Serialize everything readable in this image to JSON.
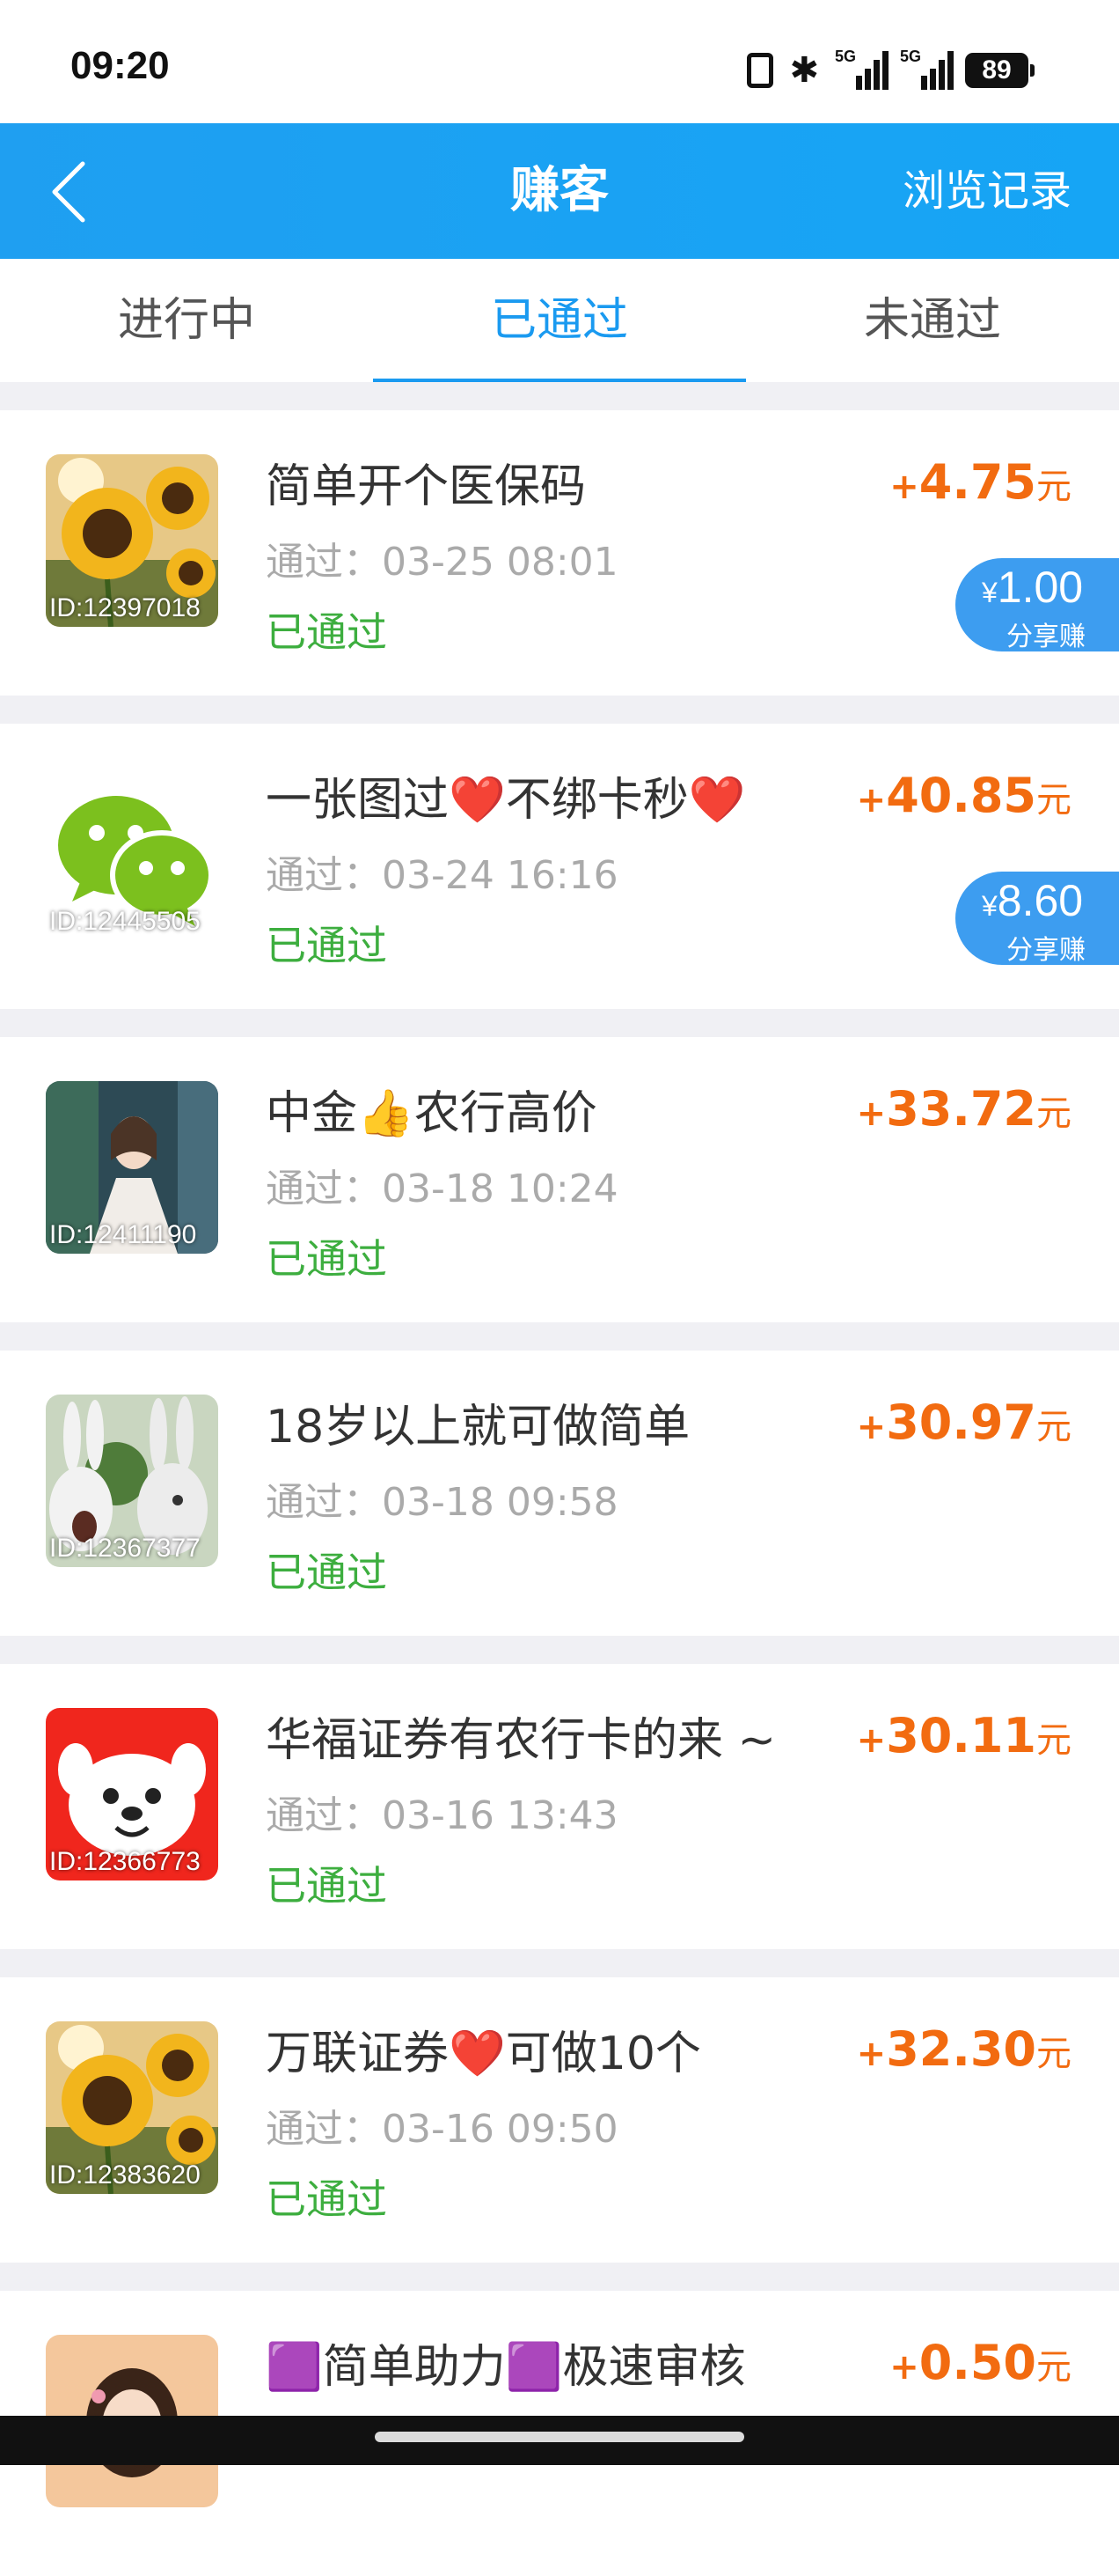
{
  "status_bar": {
    "time": "09:20",
    "battery": "89",
    "network1": "5G",
    "network2": "5G"
  },
  "header": {
    "title": "赚客",
    "history_label": "浏览记录"
  },
  "tabs": [
    {
      "label": "进行中",
      "active": false
    },
    {
      "label": "已通过",
      "active": true
    },
    {
      "label": "未通过",
      "active": false
    }
  ],
  "colors": {
    "accent": "#1a9af0",
    "reward": "#f26b10",
    "passed": "#3dae3f",
    "share_badge": "#3d9df0"
  },
  "tasks": [
    {
      "id_label": "ID:12397018",
      "image": "sunflower",
      "title": "简单开个医保码",
      "time": "通过：03-25 08:01",
      "status": "已通过",
      "plus": "+",
      "amount": "4.75",
      "unit": "元",
      "share_currency": "¥",
      "share_amount": "1.00",
      "share_label": "分享赚"
    },
    {
      "id_label": "ID:12445505",
      "image": "wechat-logo",
      "title": "一张图过❤️不绑卡秒❤️",
      "time": "通过：03-24 16:16",
      "status": "已通过",
      "plus": "+",
      "amount": "40.85",
      "unit": "元",
      "share_currency": "¥",
      "share_amount": "8.60",
      "share_label": "分享赚"
    },
    {
      "id_label": "ID:12411190",
      "image": "portrait-photo",
      "title": "中金👍农行高价",
      "time": "通过：03-18 10:24",
      "status": "已通过",
      "plus": "+",
      "amount": "33.72",
      "unit": "元"
    },
    {
      "id_label": "ID:12367377",
      "image": "rabbids",
      "title": "18岁以上就可做简单",
      "time": "通过：03-18 09:58",
      "status": "已通过",
      "plus": "+",
      "amount": "30.97",
      "unit": "元"
    },
    {
      "id_label": "ID:12366773",
      "image": "jd-dog",
      "title": "华福证券有农行卡的来 ~",
      "time": "通过：03-16 13:43",
      "status": "已通过",
      "plus": "+",
      "amount": "30.11",
      "unit": "元"
    },
    {
      "id_label": "ID:12383620",
      "image": "sunflower",
      "title": "万联证券❤️可做10个",
      "time": "通过：03-16 09:50",
      "status": "已通过",
      "plus": "+",
      "amount": "32.30",
      "unit": "元"
    },
    {
      "id_label": "",
      "image": "girl-portrait",
      "title": "🟪简单助力🟪极速审核",
      "time": "",
      "status": "",
      "plus": "+",
      "amount": "0.50",
      "unit": "元"
    }
  ]
}
